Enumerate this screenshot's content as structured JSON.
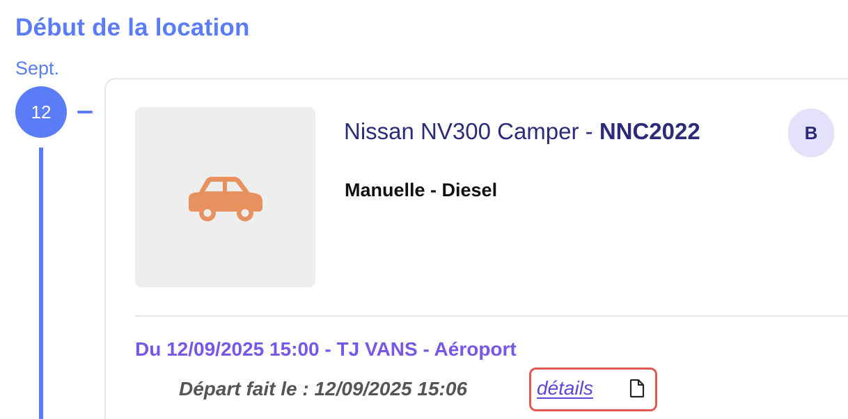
{
  "section": {
    "title": "Début de la location"
  },
  "timeline": {
    "month": "Sept.",
    "day": "12"
  },
  "vehicle": {
    "image_icon": "car-icon",
    "title": "Nissan NV300 Camper - ",
    "plate": "NNC2022",
    "badge": "B",
    "subtitle": "Manuelle - Diesel"
  },
  "rental": {
    "period": "Du 12/09/2025 15:00 - TJ VANS - Aéroport",
    "departure": "Départ fait le : 12/09/2025 15:06",
    "details_label": "détails",
    "details_icon": "document-icon"
  },
  "colors": {
    "primary": "#5b7cf7",
    "title_dark": "#2d2a7a",
    "period_purple": "#7658e8",
    "car_orange": "#e8915f",
    "highlight_red": "#e05a50"
  }
}
